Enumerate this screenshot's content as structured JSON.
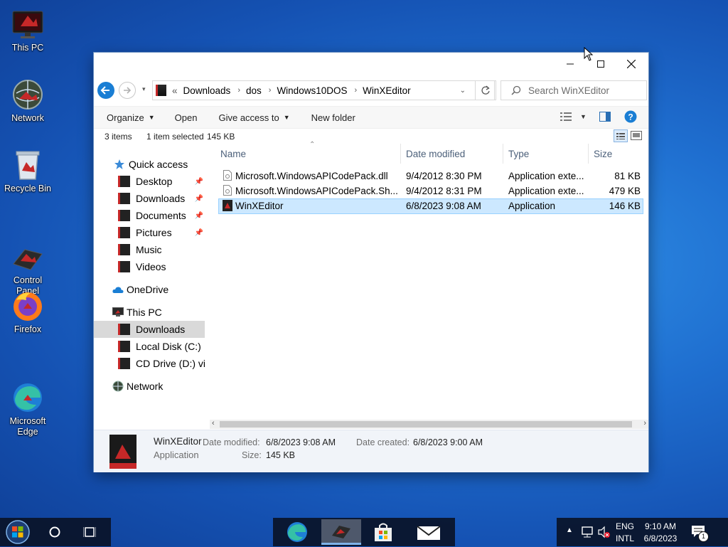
{
  "desktop": {
    "icons": [
      {
        "label": "This PC",
        "icon": "monitor-icon"
      },
      {
        "label": "Network",
        "icon": "globe-icon"
      },
      {
        "label": "Recycle Bin",
        "icon": "recycle-bin-icon"
      },
      {
        "label": "Control\nPanel",
        "icon": "control-panel-icon"
      },
      {
        "label": "Firefox",
        "icon": "firefox-icon"
      },
      {
        "label": "Microsoft\nEdge",
        "icon": "edge-icon"
      }
    ]
  },
  "window": {
    "address": {
      "overflow": "«",
      "segments": [
        "Downloads",
        "dos",
        "Windows10DOS",
        "WinXEditor"
      ]
    },
    "search_placeholder": "Search WinXEditor",
    "toolbar": {
      "organize": "Organize",
      "open": "Open",
      "give_access": "Give access to",
      "new_folder": "New folder"
    },
    "status": {
      "items": "3 items",
      "selected": "1 item selected",
      "size": "145 KB"
    },
    "nav": {
      "quick_access": "Quick access",
      "quick_items": [
        "Desktop",
        "Downloads",
        "Documents",
        "Pictures",
        "Music",
        "Videos"
      ],
      "onedrive": "OneDrive",
      "this_pc": "This PC",
      "pc_items": [
        "Downloads",
        "Local Disk (C:)",
        "CD Drive (D:) virtio"
      ],
      "network": "Network"
    },
    "columns": {
      "name": "Name",
      "date": "Date modified",
      "type": "Type",
      "size": "Size"
    },
    "files": [
      {
        "name": "Microsoft.WindowsAPICodePack.dll",
        "date": "9/4/2012 8:30 PM",
        "type": "Application exte...",
        "size": "81 KB"
      },
      {
        "name": "Microsoft.WindowsAPICodePack.Sh...",
        "date": "9/4/2012 8:31 PM",
        "type": "Application exte...",
        "size": "479 KB"
      },
      {
        "name": "WinXEditor",
        "date": "6/8/2023 9:08 AM",
        "type": "Application",
        "size": "146 KB"
      }
    ],
    "details": {
      "name": "WinXEditor",
      "kind": "Application",
      "date_modified_label": "Date modified:",
      "date_modified": "6/8/2023 9:08 AM",
      "date_created_label": "Date created:",
      "date_created": "6/8/2023 9:00 AM",
      "size_label": "Size:",
      "size": "145 KB"
    }
  },
  "taskbar": {
    "lang1": "ENG",
    "lang2": "INTL",
    "time": "9:10 AM",
    "date": "6/8/2023",
    "notification_count": "1"
  },
  "colors": {
    "accent": "#0078d7",
    "selection": "#cce8ff"
  }
}
